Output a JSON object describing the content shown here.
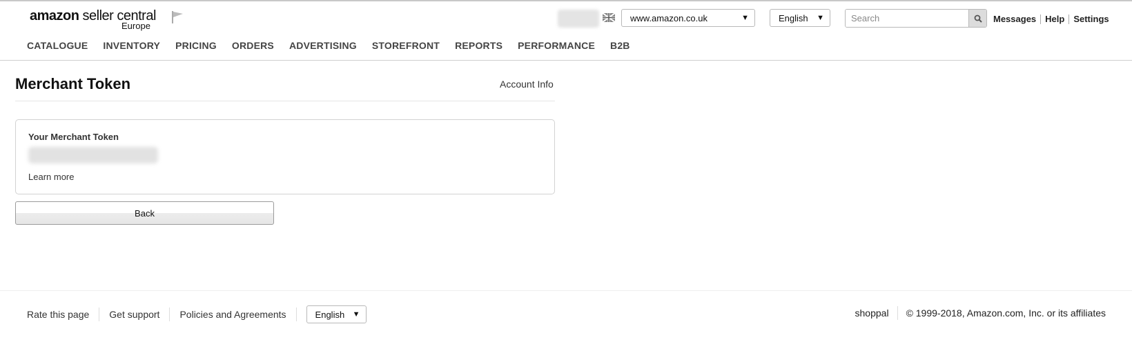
{
  "header": {
    "logo_main_bold": "amazon",
    "logo_main_light": " seller central",
    "logo_sub": "Europe",
    "marketplace": "www.amazon.co.uk",
    "language": "English",
    "search_placeholder": "Search",
    "links": [
      "Messages",
      "Help",
      "Settings"
    ],
    "icons": [
      "flag-icon",
      "uk-flag-icon",
      "search-icon"
    ]
  },
  "nav": {
    "items": [
      "CATALOGUE",
      "INVENTORY",
      "PRICING",
      "ORDERS",
      "ADVERTISING",
      "STOREFRONT",
      "REPORTS",
      "PERFORMANCE",
      "B2B"
    ]
  },
  "main": {
    "title": "Merchant Token",
    "account_info": "Account Info",
    "token_label": "Your Merchant Token",
    "learn_more": "Learn more",
    "back_label": "Back"
  },
  "footer": {
    "links": [
      "Rate this page",
      "Get support",
      "Policies and Agreements"
    ],
    "language": "English",
    "store_name": "shoppal",
    "copyright": "© 1999-2018, Amazon.com, Inc. or its affiliates"
  },
  "colors": {
    "text": "#111111",
    "nav_text": "#444444",
    "border": "#d2d2d2",
    "search_button": "#dcdcdc"
  }
}
